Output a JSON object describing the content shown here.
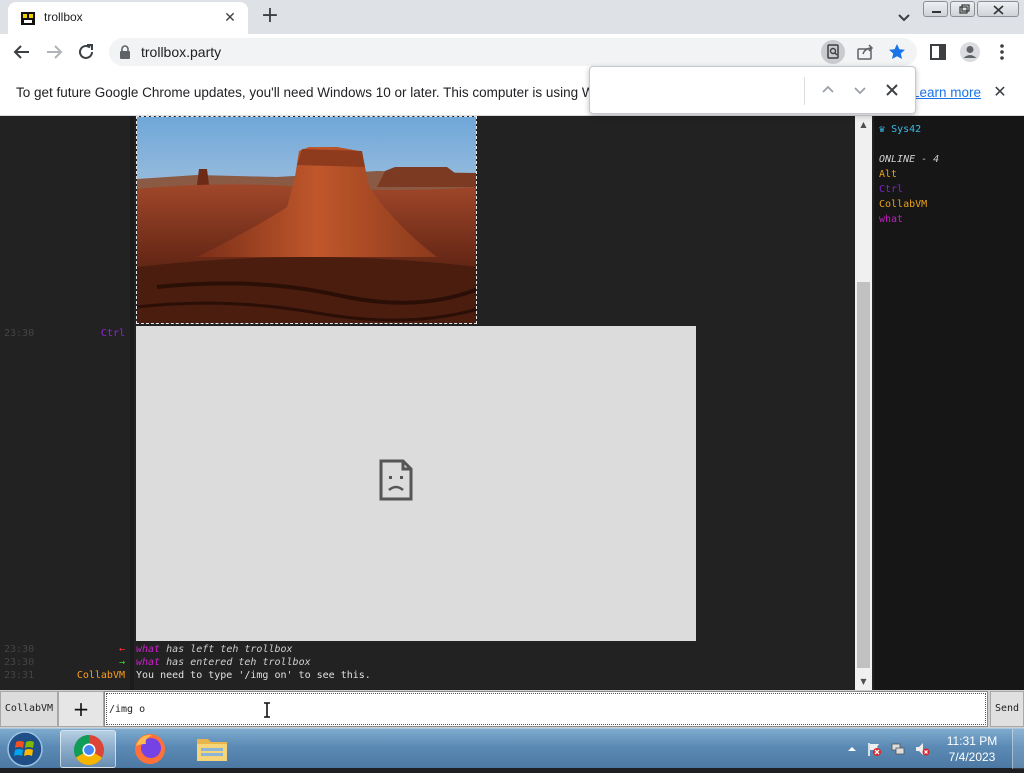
{
  "browser": {
    "tab_title": "trollbox",
    "url": "trollbox.party"
  },
  "infobar": {
    "text": "To get future Google Chrome updates, you'll need Windows 10 or later. This computer is using Wind",
    "link": "Learn more"
  },
  "findbar": {
    "value": ""
  },
  "chat": {
    "lines": [
      {
        "time": "23:30",
        "nick": "Ctrl",
        "nick_color": "#8e24d6",
        "text": ""
      },
      {
        "time": "23:30",
        "arrow": "←",
        "arrow_color": "#ff3333",
        "user": "what",
        "user_color": "#d01ed0",
        "text": "has left teh trollbox"
      },
      {
        "time": "23:30",
        "arrow": "→",
        "arrow_color": "#33dd33",
        "user": "what",
        "user_color": "#d01ed0",
        "text": "has entered teh trollbox"
      },
      {
        "time": "23:31",
        "nick": "CollabVM",
        "nick_color": "#ff9f1c",
        "text": "You need to type '/img on' to see this."
      }
    ]
  },
  "userlist": {
    "self": "Sys42",
    "self_color": "#3fb8e8",
    "online_label": "ONLINE - 4",
    "users": [
      {
        "name": "Alt",
        "color": "#e8a21c"
      },
      {
        "name": "Ctrl",
        "color": "#7b24c6"
      },
      {
        "name": "CollabVM",
        "color": "#e8a21c"
      },
      {
        "name": "what",
        "color": "#c01ec0"
      }
    ]
  },
  "input": {
    "nick_button": "CollabVM",
    "plus_button": "+",
    "message": "/img o",
    "send_button": "Send"
  },
  "taskbar": {
    "time": "11:31 PM",
    "date": "7/4/2023"
  }
}
